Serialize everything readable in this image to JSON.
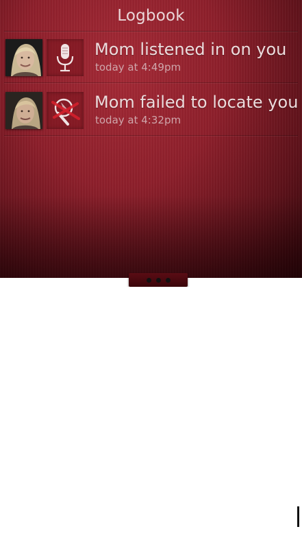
{
  "header": {
    "title": "Logbook"
  },
  "entries": [
    {
      "text": "Mom listened in on you",
      "time": "today at 4:49pm",
      "action_icon": "microphone-icon"
    },
    {
      "text": "Mom failed to locate you",
      "time": "today at 4:32pm",
      "action_icon": "locate-failed-icon"
    }
  ],
  "colors": {
    "panel": "#8e1f2b",
    "panel_dark": "#2e0509",
    "text": "#ecdcdd",
    "subtext": "#cfa6ab",
    "accent_red": "#d4202c"
  }
}
